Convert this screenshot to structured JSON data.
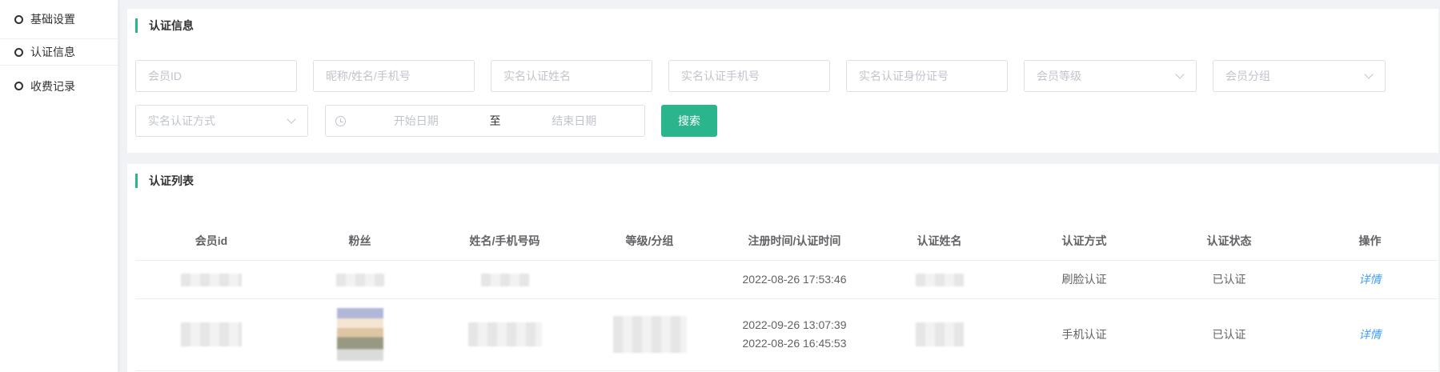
{
  "sidebar": {
    "items": [
      {
        "label": "基础设置"
      },
      {
        "label": "认证信息"
      },
      {
        "label": "收费记录"
      }
    ]
  },
  "filter": {
    "title": "认证信息",
    "member_id_placeholder": "会员ID",
    "nickname_placeholder": "昵称/姓名/手机号",
    "real_name_placeholder": "实名认证姓名",
    "real_phone_placeholder": "实名认证手机号",
    "real_idcard_placeholder": "实名认证身份证号",
    "level_placeholder": "会员等级",
    "group_placeholder": "会员分组",
    "method_placeholder": "实名认证方式",
    "start_date_placeholder": "开始日期",
    "range_separator": "至",
    "end_date_placeholder": "结束日期",
    "search_label": "搜索"
  },
  "list": {
    "title": "认证列表",
    "columns": [
      "会员id",
      "粉丝",
      "姓名/手机号码",
      "等级/分组",
      "注册时间/认证时间",
      "认证姓名",
      "认证方式",
      "认证状态",
      "操作"
    ],
    "rows": [
      {
        "time1": "2022-08-26 17:53:46",
        "time2": "",
        "method": "刷脸认证",
        "status": "已认证",
        "action": "详情"
      },
      {
        "time1": "2022-09-26 13:07:39",
        "time2": "2022-08-26 16:45:53",
        "method": "手机认证",
        "status": "已认证",
        "action": "详情"
      }
    ]
  },
  "colors": {
    "accent": "#2ab58c",
    "link": "#409eff"
  }
}
